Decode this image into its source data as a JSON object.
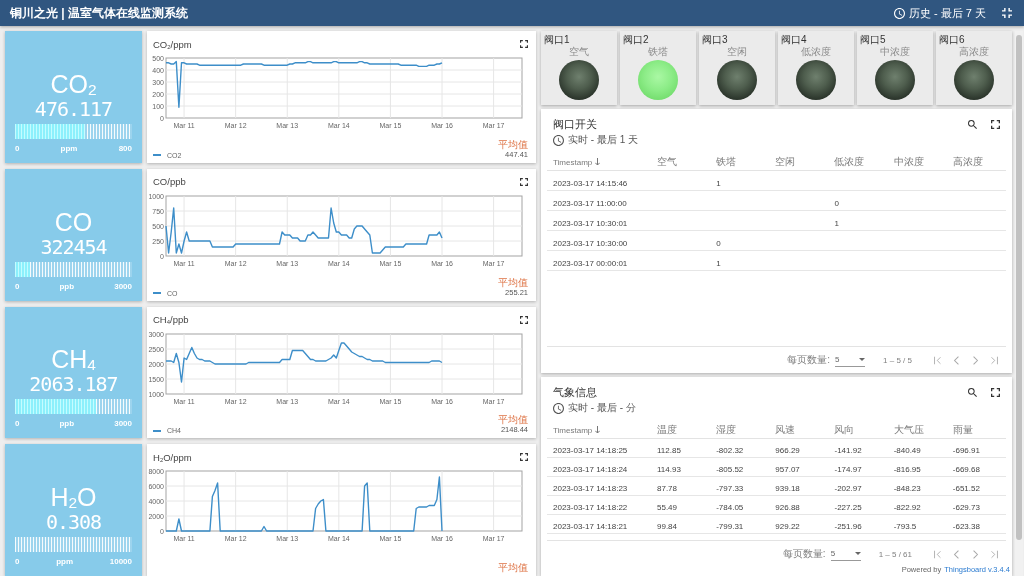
{
  "header": {
    "title": "铜川之光 | 温室气体在线监测系统",
    "timewindow": "历史 - 最后 7 天"
  },
  "gauges": [
    {
      "title": "CO$_{2}$",
      "value": "476.117",
      "level": 0.6,
      "min": "0",
      "unit": "ppm",
      "max": "800"
    },
    {
      "title": "CO",
      "value": "322454",
      "level": 0.13,
      "min": "0",
      "unit": "ppb",
      "max": "3000"
    },
    {
      "title": "CH$_{4}$",
      "value": "2063.187",
      "level": 0.69,
      "min": "0",
      "unit": "ppb",
      "max": "3000"
    },
    {
      "title": "H$_{2}$O",
      "value": "0.308",
      "min": "0",
      "unit": "ppm",
      "max": "10000"
    }
  ],
  "charts": [
    {
      "title": "CO$_{2}$/ppm",
      "chart_data": {
        "type": "line",
        "grid": true,
        "categories": [
          null,
          null,
          null,
          null,
          null,
          null,
          null,
          "Mar 11",
          null,
          null,
          null,
          null,
          null,
          null,
          null,
          null,
          null,
          null,
          null,
          null,
          null,
          null,
          null,
          null,
          null,
          null,
          null,
          "Mar 12",
          null,
          null,
          null,
          null,
          null,
          null,
          null,
          null,
          null,
          null,
          null,
          null,
          null,
          null,
          null,
          null,
          null,
          null,
          null,
          "Mar 13",
          null,
          null,
          null,
          null,
          null,
          null,
          null,
          null,
          null,
          null,
          null,
          null,
          null,
          null,
          null,
          null,
          null,
          null,
          null,
          "Mar 14",
          null,
          null,
          null,
          null,
          null,
          null,
          null,
          null,
          null,
          null,
          null,
          null,
          null,
          null,
          null,
          null,
          null,
          null,
          null,
          "Mar 15",
          null,
          null,
          null,
          null,
          null,
          null,
          null,
          null,
          null,
          null,
          null,
          null,
          null,
          null,
          null,
          null,
          null,
          null,
          null,
          "Mar 16",
          null,
          null,
          null,
          null,
          null,
          null,
          null,
          null,
          null,
          null,
          null,
          null,
          null,
          null,
          null,
          null,
          null,
          null,
          null,
          "Mar 17",
          null,
          null,
          null,
          null,
          null,
          null,
          null,
          null,
          null,
          null,
          null
        ],
        "series": [
          {
            "name": "CO2",
            "color": "#3d8ec9",
            "values": [
              460,
              460,
              450,
              450,
              470,
              90,
              460,
              460,
              450,
              450,
              450,
              450,
              450,
              440,
              440,
              440,
              440,
              440,
              440,
              440,
              440,
              440,
              440,
              440,
              440,
              440,
              440,
              440,
              440,
              440,
              450,
              450,
              450,
              450,
              450,
              450,
              450,
              450,
              440,
              440,
              440,
              440,
              440,
              440,
              440,
              440,
              440,
              440,
              450,
              450,
              460,
              460,
              460,
              460,
              460,
              470,
              470,
              460,
              460,
              460,
              460,
              460,
              460,
              460,
              460,
              470,
              470,
              460,
              460,
              460,
              460,
              460,
              460,
              460,
              460,
              470,
              470,
              460,
              460,
              450,
              450,
              450,
              450,
              450,
              450,
              450,
              450,
              450,
              450,
              450,
              450,
              440,
              440,
              440,
              440,
              440,
              440,
              440,
              430,
              430,
              430,
              430,
              440,
              440,
              440,
              450,
              450,
              460,
              null,
              null,
              null,
              null,
              null,
              null,
              null,
              null,
              null,
              null,
              null,
              null,
              null,
              null,
              null,
              null,
              null,
              null,
              null,
              null,
              null,
              null,
              null,
              null,
              null,
              null,
              null,
              null,
              null,
              null,
              null
            ]
          }
        ],
        "ylim": [
          0,
          500
        ],
        "yticks": [
          0,
          100,
          200,
          300,
          400,
          500
        ]
      },
      "avg_label": "平均值",
      "avg_value": "447.41"
    },
    {
      "title": "CO/ppb",
      "chart_data": {
        "type": "line",
        "grid": true,
        "categories": [
          null,
          null,
          null,
          null,
          null,
          null,
          null,
          "Mar 11",
          null,
          null,
          null,
          null,
          null,
          null,
          null,
          null,
          null,
          null,
          null,
          null,
          null,
          null,
          null,
          null,
          null,
          null,
          null,
          "Mar 12",
          null,
          null,
          null,
          null,
          null,
          null,
          null,
          null,
          null,
          null,
          null,
          null,
          null,
          null,
          null,
          null,
          null,
          null,
          null,
          "Mar 13",
          null,
          null,
          null,
          null,
          null,
          null,
          null,
          null,
          null,
          null,
          null,
          null,
          null,
          null,
          null,
          null,
          null,
          null,
          null,
          "Mar 14",
          null,
          null,
          null,
          null,
          null,
          null,
          null,
          null,
          null,
          null,
          null,
          null,
          null,
          null,
          null,
          null,
          null,
          null,
          null,
          "Mar 15",
          null,
          null,
          null,
          null,
          null,
          null,
          null,
          null,
          null,
          null,
          null,
          null,
          null,
          null,
          null,
          null,
          null,
          null,
          null,
          "Mar 16",
          null,
          null,
          null,
          null,
          null,
          null,
          null,
          null,
          null,
          null,
          null,
          null,
          null,
          null,
          null,
          null,
          null,
          null,
          null,
          "Mar 17",
          null,
          null,
          null,
          null,
          null,
          null,
          null,
          null,
          null,
          null,
          null
        ],
        "series": [
          {
            "name": "CO",
            "color": "#3d8ec9",
            "values": [
              500,
              50,
              400,
              800,
              50,
              200,
              50,
              250,
              400,
              250,
              250,
              250,
              250,
              250,
              250,
              250,
              250,
              250,
              150,
              150,
              150,
              150,
              150,
              150,
              150,
              150,
              150,
              200,
              200,
              200,
              200,
              200,
              200,
              200,
              200,
              200,
              200,
              200,
              200,
              200,
              200,
              200,
              200,
              200,
              200,
              400,
              350,
              350,
              350,
              300,
              300,
              300,
              250,
              250,
              250,
              350,
              350,
              400,
              350,
              300,
              300,
              300,
              300,
              300,
              800,
              550,
              400,
              400,
              350,
              350,
              350,
              300,
              300,
              450,
              500,
              500,
              500,
              450,
              400,
              350,
              50,
              50,
              50,
              50,
              100,
              150,
              150,
              150,
              150,
              150,
              150,
              150,
              150,
              200,
              200,
              200,
              200,
              200,
              200,
              200,
              200,
              200,
              350,
              350,
              350,
              350,
              400,
              300,
              null,
              null,
              null,
              null,
              null,
              null,
              null,
              null,
              null,
              null,
              null,
              null,
              null,
              null,
              null,
              null,
              null,
              null,
              null,
              null,
              null,
              null,
              null,
              null,
              null,
              null,
              null,
              null,
              null,
              null,
              null
            ]
          }
        ],
        "ylim": [
          0,
          1000
        ],
        "yticks": [
          0,
          250,
          500,
          750,
          1000
        ]
      },
      "avg_label": "平均值",
      "avg_value": "255.21"
    },
    {
      "title": "CH$_{4}$/ppb",
      "chart_data": {
        "type": "line",
        "grid": true,
        "categories": [
          null,
          null,
          null,
          null,
          null,
          null,
          null,
          "Mar 11",
          null,
          null,
          null,
          null,
          null,
          null,
          null,
          null,
          null,
          null,
          null,
          null,
          null,
          null,
          null,
          null,
          null,
          null,
          null,
          "Mar 12",
          null,
          null,
          null,
          null,
          null,
          null,
          null,
          null,
          null,
          null,
          null,
          null,
          null,
          null,
          null,
          null,
          null,
          null,
          null,
          "Mar 13",
          null,
          null,
          null,
          null,
          null,
          null,
          null,
          null,
          null,
          null,
          null,
          null,
          null,
          null,
          null,
          null,
          null,
          null,
          null,
          "Mar 14",
          null,
          null,
          null,
          null,
          null,
          null,
          null,
          null,
          null,
          null,
          null,
          null,
          null,
          null,
          null,
          null,
          null,
          null,
          null,
          "Mar 15",
          null,
          null,
          null,
          null,
          null,
          null,
          null,
          null,
          null,
          null,
          null,
          null,
          null,
          null,
          null,
          null,
          null,
          null,
          null,
          "Mar 16",
          null,
          null,
          null,
          null,
          null,
          null,
          null,
          null,
          null,
          null,
          null,
          null,
          null,
          null,
          null,
          null,
          null,
          null,
          null,
          "Mar 17",
          null,
          null,
          null,
          null,
          null,
          null,
          null,
          null,
          null,
          null,
          null
        ],
        "series": [
          {
            "name": "CH4",
            "color": "#3d8ec9",
            "values": [
              2100,
              2100,
              2100,
              2050,
              2350,
              2050,
              1400,
              2200,
              2150,
              2350,
              2550,
              2350,
              2200,
              2150,
              2150,
              2100,
              2100,
              2100,
              2050,
              2000,
              2000,
              2000,
              2000,
              2000,
              2000,
              2000,
              2000,
              2000,
              2000,
              2000,
              2000,
              2000,
              2050,
              2050,
              2050,
              2050,
              2050,
              2050,
              2050,
              2050,
              2050,
              2050,
              2050,
              2050,
              2050,
              2150,
              2150,
              2150,
              2150,
              2450,
              2450,
              2450,
              2450,
              2450,
              2350,
              2250,
              2150,
              2150,
              2100,
              2100,
              2100,
              2100,
              2100,
              2150,
              2200,
              2300,
              2200,
              2450,
              2700,
              2700,
              2600,
              2500,
              2400,
              2350,
              2300,
              2250,
              2250,
              2200,
              2150,
              2150,
              2100,
              2100,
              2100,
              2100,
              2100,
              2050,
              2050,
              2050,
              2050,
              2050,
              2050,
              2050,
              2050,
              2050,
              2050,
              2050,
              2050,
              2050,
              2050,
              2050,
              2050,
              2050,
              2050,
              2100,
              2100,
              2100,
              2100,
              2050,
              null,
              null,
              null,
              null,
              null,
              null,
              null,
              null,
              null,
              null,
              null,
              null,
              null,
              null,
              null,
              null,
              null,
              null,
              null,
              null,
              null,
              null,
              null,
              null,
              null,
              null,
              null,
              null,
              null,
              null,
              null
            ]
          }
        ],
        "ylim": [
          1000,
          3000
        ],
        "yticks": [
          1000,
          1500,
          2000,
          2500,
          3000
        ]
      },
      "avg_label": "平均值",
      "avg_value": "2148.44"
    },
    {
      "title": "H$_{2}$O/ppm",
      "chart_data": {
        "type": "line",
        "grid": true,
        "categories": [
          null,
          null,
          null,
          null,
          null,
          null,
          null,
          "Mar 11",
          null,
          null,
          null,
          null,
          null,
          null,
          null,
          null,
          null,
          null,
          null,
          null,
          null,
          null,
          null,
          null,
          null,
          null,
          null,
          "Mar 12",
          null,
          null,
          null,
          null,
          null,
          null,
          null,
          null,
          null,
          null,
          null,
          null,
          null,
          null,
          null,
          null,
          null,
          null,
          null,
          "Mar 13",
          null,
          null,
          null,
          null,
          null,
          null,
          null,
          null,
          null,
          null,
          null,
          null,
          null,
          null,
          null,
          null,
          null,
          null,
          null,
          "Mar 14",
          null,
          null,
          null,
          null,
          null,
          null,
          null,
          null,
          null,
          null,
          null,
          null,
          null,
          null,
          null,
          null,
          null,
          null,
          null,
          "Mar 15",
          null,
          null,
          null,
          null,
          null,
          null,
          null,
          null,
          null,
          null,
          null,
          null,
          null,
          null,
          null,
          null,
          null,
          null,
          null,
          "Mar 16",
          null,
          null,
          null,
          null,
          null,
          null,
          null,
          null,
          null,
          null,
          null,
          null,
          null,
          null,
          null,
          null,
          null,
          null,
          null,
          "Mar 17",
          null,
          null,
          null,
          null,
          null,
          null,
          null,
          null,
          null,
          null,
          null
        ],
        "series": [
          {
            "color": "#3d8ec9",
            "values": [
              0,
              0,
              0,
              0,
              0,
              1600,
              0,
              0,
              0,
              0,
              0,
              0,
              0,
              0,
              0,
              0,
              0,
              0,
              4600,
              5400,
              6400,
              0,
              0,
              0,
              0,
              0,
              0,
              0,
              0,
              0,
              0,
              0,
              0,
              0,
              0,
              0,
              0,
              0,
              600,
              0,
              0,
              0,
              0,
              0,
              0,
              0,
              0,
              0,
              0,
              0,
              0,
              0,
              0,
              0,
              0,
              0,
              0,
              0,
              3000,
              3600,
              4000,
              4200,
              0,
              0,
              0,
              0,
              0,
              0,
              0,
              0,
              0,
              0,
              0,
              0,
              0,
              0,
              0,
              6000,
              6400,
              0,
              0,
              0,
              0,
              0,
              0,
              0,
              0,
              0,
              0,
              0,
              0,
              0,
              0,
              0,
              0,
              0,
              0,
              3000,
              3200,
              3200,
              3200,
              3200,
              3400,
              3400,
              3400,
              4200,
              7200,
              0,
              null,
              null,
              null,
              null,
              null,
              null,
              null,
              null,
              null,
              null,
              null,
              null,
              null,
              null,
              null,
              null,
              null,
              null,
              null,
              null,
              null,
              null,
              null,
              null,
              null,
              null,
              null,
              null,
              null,
              null,
              null
            ]
          }
        ],
        "ylim": [
          0,
          8000
        ],
        "yticks": [
          0,
          2000,
          4000,
          6000,
          8000
        ]
      },
      "avg_label": "平均值"
    }
  ],
  "valves": [
    {
      "title": "阀口1",
      "label": "空气",
      "on": false
    },
    {
      "title": "阀口2",
      "label": "铁塔",
      "on": true
    },
    {
      "title": "阀口3",
      "label": "空闲",
      "on": false
    },
    {
      "title": "阀口4",
      "label": "低浓度",
      "on": false
    },
    {
      "title": "阀口5",
      "label": "中浓度",
      "on": false
    },
    {
      "title": "阀口6",
      "label": "高浓度",
      "on": false
    }
  ],
  "tables": [
    {
      "title": "阀口开关",
      "timewindow": "实时 - 最后 1 天",
      "columns": [
        {
          "label": "Timestamp",
          "sorted": true
        },
        {
          "label": "空气",
          "sorted": false
        },
        {
          "label": "铁塔",
          "sorted": false
        },
        {
          "label": "空闲",
          "sorted": false
        },
        {
          "label": "低浓度",
          "sorted": false
        },
        {
          "label": "中浓度",
          "sorted": false
        },
        {
          "label": "高浓度",
          "sorted": false
        }
      ],
      "rows": [
        {
          "cells": [
            "2023-03-17 14:15:46",
            null,
            "1",
            null,
            null,
            null,
            null
          ]
        },
        {
          "cells": [
            "2023-03-17 11:00:00",
            null,
            null,
            null,
            "0",
            null,
            null
          ]
        },
        {
          "cells": [
            "2023-03-17 10:30:01",
            null,
            null,
            null,
            "1",
            null,
            null
          ]
        },
        {
          "cells": [
            "2023-03-17 10:30:00",
            null,
            "0",
            null,
            null,
            null,
            null
          ]
        },
        {
          "cells": [
            "2023-03-17 00:00:01",
            null,
            "1",
            null,
            null,
            null,
            null
          ]
        }
      ],
      "paginator": {
        "page_size_label": "每页数量:",
        "page_size": "5",
        "range": "1 – 5 / 5"
      }
    },
    {
      "title": "气象信息",
      "timewindow": "实时 - 最后 - 分",
      "columns": [
        {
          "label": "Timestamp",
          "sorted": true
        },
        {
          "label": "温度",
          "sorted": false
        },
        {
          "label": "湿度",
          "sorted": false
        },
        {
          "label": "风速",
          "sorted": false
        },
        {
          "label": "风向",
          "sorted": false
        },
        {
          "label": "大气压",
          "sorted": false
        },
        {
          "label": "雨量",
          "sorted": false
        }
      ],
      "rows": [
        {
          "cells": [
            "2023-03-17 14:18:25",
            "112.85",
            "-802.32",
            "966.29",
            "-141.92",
            "-840.49",
            "-696.91"
          ]
        },
        {
          "cells": [
            "2023-03-17 14:18:24",
            "114.93",
            "-805.52",
            "957.07",
            "-174.97",
            "-816.95",
            "-669.68"
          ]
        },
        {
          "cells": [
            "2023-03-17 14:18:23",
            "87.78",
            "-797.33",
            "939.18",
            "-202.97",
            "-848.23",
            "-651.52"
          ]
        },
        {
          "cells": [
            "2023-03-17 14:18:22",
            "55.49",
            "-784.05",
            "926.88",
            "-227.25",
            "-822.92",
            "-629.73"
          ]
        },
        {
          "cells": [
            "2023-03-17 14:18:21",
            "99.84",
            "-799.31",
            "929.22",
            "-251.96",
            "-793.5",
            "-623.38"
          ]
        }
      ],
      "paginator": {
        "page_size_label": "每页数量:",
        "page_size": "5",
        "range": "1 – 5 / 61"
      }
    }
  ],
  "footer": {
    "text": "Powered by",
    "link": "Thingsboard v.3.4.4"
  }
}
